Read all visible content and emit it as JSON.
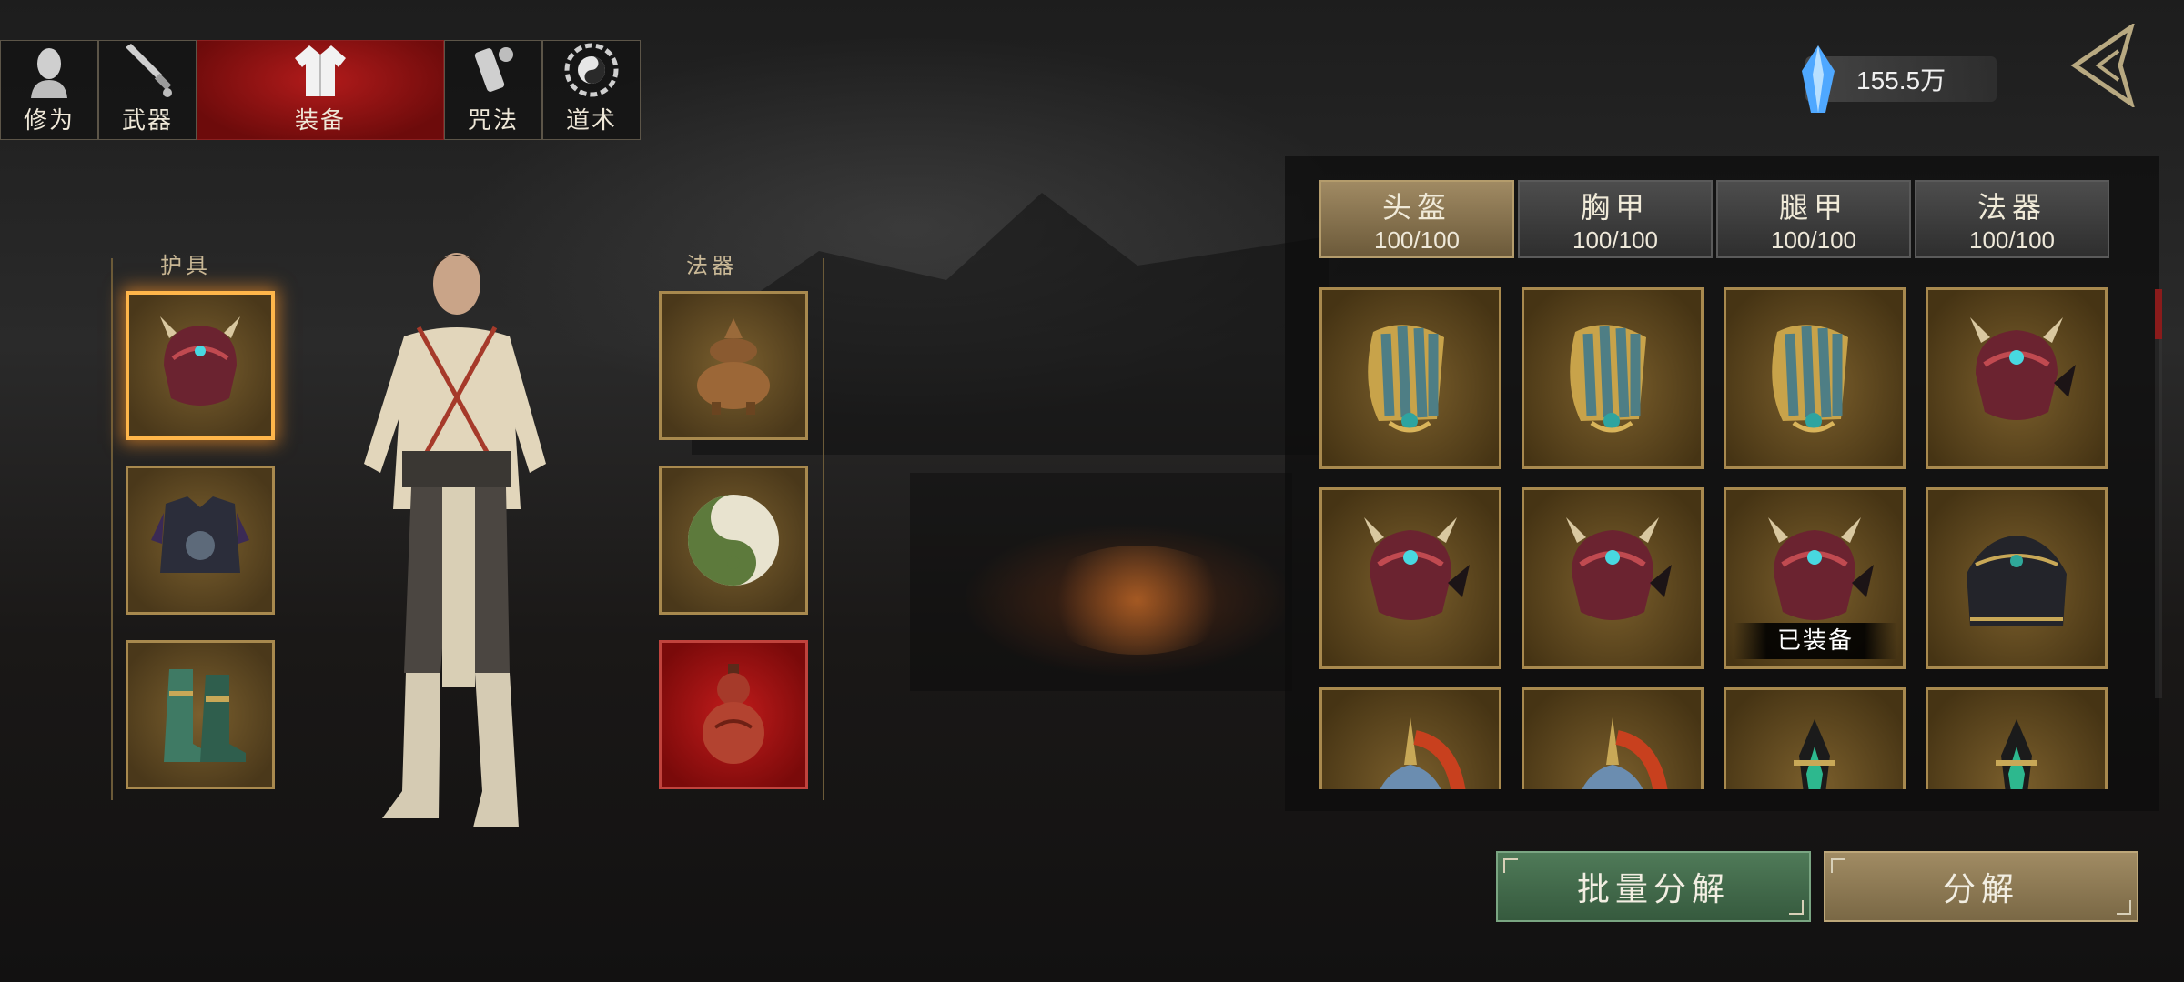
{
  "top_tabs": [
    {
      "label": "修为",
      "icon": "cultivation-head-icon"
    },
    {
      "label": "武器",
      "icon": "weapon-icon"
    },
    {
      "label": "装备",
      "icon": "robe-icon",
      "active": true
    },
    {
      "label": "咒法",
      "icon": "scroll-gourd-icon"
    },
    {
      "label": "道术",
      "icon": "bagua-icon"
    }
  ],
  "currency": {
    "value": "155.5万",
    "icon": "spirit-crystal-icon"
  },
  "sections": {
    "armor_label": "护具",
    "artifact_label": "法器"
  },
  "armor_slots": [
    {
      "item": "demon-helmet",
      "selected": true
    },
    {
      "item": "chest-armor"
    },
    {
      "item": "green-boots"
    }
  ],
  "artifact_slots": [
    {
      "item": "bronze-incense-burner"
    },
    {
      "item": "yin-yang-jade"
    },
    {
      "item": "red-gourd",
      "highlight": "red"
    }
  ],
  "category_tabs": [
    {
      "name": "头盔",
      "count": "100/100",
      "active": true
    },
    {
      "name": "胸甲",
      "count": "100/100"
    },
    {
      "name": "腿甲",
      "count": "100/100"
    },
    {
      "name": "法器",
      "count": "100/100"
    }
  ],
  "inventory": [
    {
      "item": "jade-shoulder-guard"
    },
    {
      "item": "jade-shoulder-guard"
    },
    {
      "item": "jade-shoulder-guard"
    },
    {
      "item": "demon-helmet"
    },
    {
      "item": "demon-helmet"
    },
    {
      "item": "demon-helmet"
    },
    {
      "item": "demon-helmet",
      "tag": "已装备"
    },
    {
      "item": "black-cloth-hood"
    },
    {
      "item": "plumed-helmet"
    },
    {
      "item": "plumed-helmet"
    },
    {
      "item": "green-blade-talisman"
    },
    {
      "item": "green-blade-talisman"
    }
  ],
  "buttons": {
    "batch_decompose": "批量分解",
    "decompose": "分解"
  },
  "colors": {
    "active_tab": "#b21b1b",
    "gold_border": "#a8894e",
    "batch_button": "#4f7a58",
    "decompose_button": "#a08b63"
  }
}
